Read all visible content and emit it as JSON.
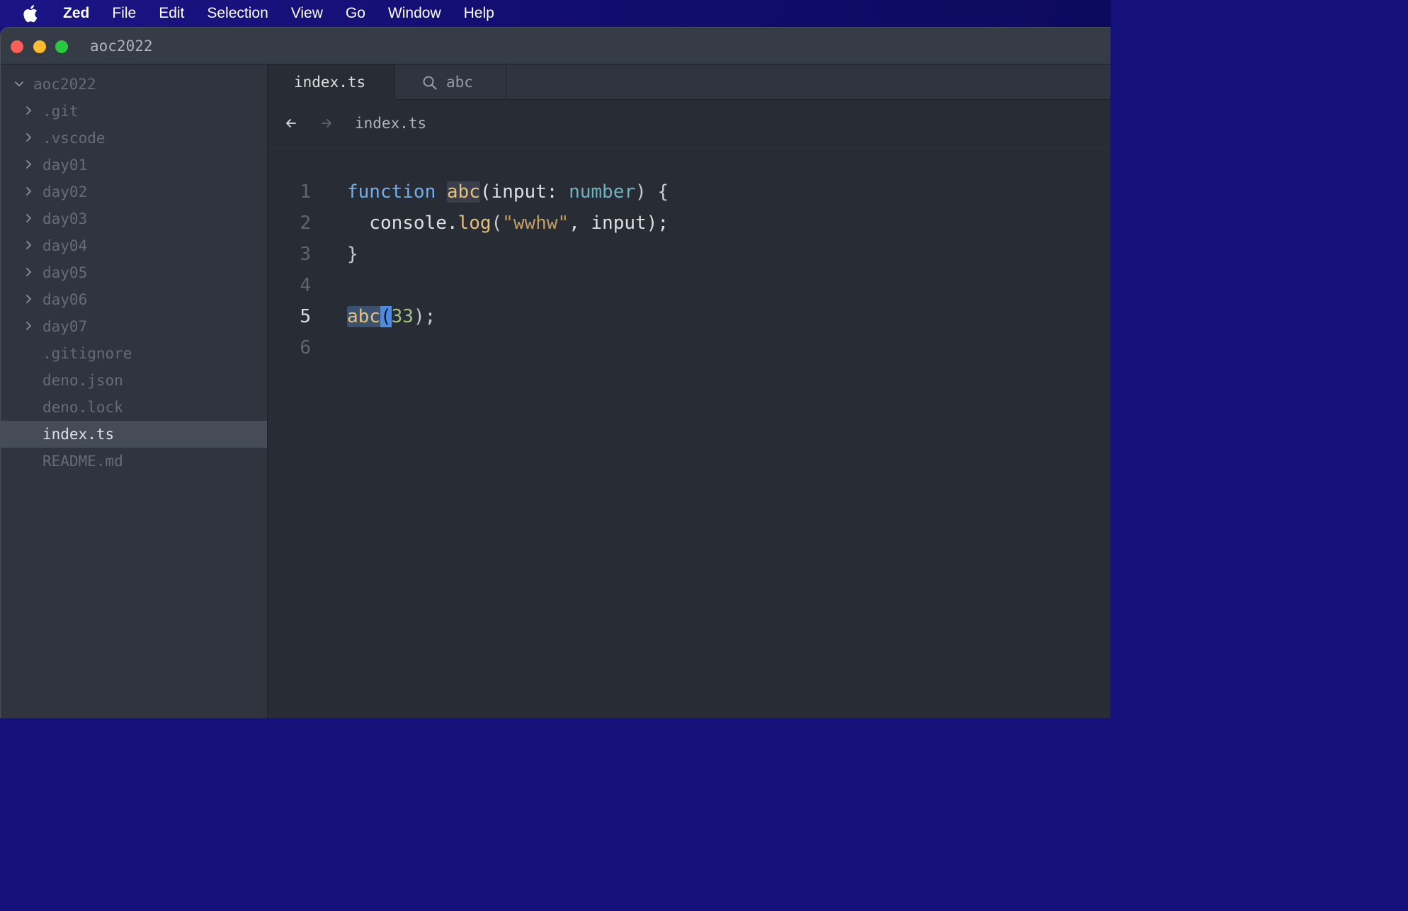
{
  "menubar": {
    "app_name": "Zed",
    "items": [
      "File",
      "Edit",
      "Selection",
      "View",
      "Go",
      "Window",
      "Help"
    ]
  },
  "window": {
    "title": "aoc2022"
  },
  "sidebar": {
    "root": "aoc2022",
    "items": [
      {
        "label": ".git",
        "type": "folder"
      },
      {
        "label": ".vscode",
        "type": "folder"
      },
      {
        "label": "day01",
        "type": "folder"
      },
      {
        "label": "day02",
        "type": "folder"
      },
      {
        "label": "day03",
        "type": "folder"
      },
      {
        "label": "day04",
        "type": "folder"
      },
      {
        "label": "day05",
        "type": "folder"
      },
      {
        "label": "day06",
        "type": "folder"
      },
      {
        "label": "day07",
        "type": "folder"
      },
      {
        "label": ".gitignore",
        "type": "file"
      },
      {
        "label": "deno.json",
        "type": "file"
      },
      {
        "label": "deno.lock",
        "type": "file"
      },
      {
        "label": "index.ts",
        "type": "file",
        "selected": true
      },
      {
        "label": "README.md",
        "type": "file"
      }
    ]
  },
  "tabs": [
    {
      "label": "index.ts",
      "active": true
    },
    {
      "label": "abc",
      "icon": "search-icon",
      "active": false
    }
  ],
  "toolbar": {
    "breadcrumb": "index.ts"
  },
  "editor": {
    "current_line": 5,
    "lines": [
      {
        "number": "1",
        "tokens": [
          {
            "t": "function",
            "c": "kw"
          },
          {
            "t": " ",
            "c": ""
          },
          {
            "t": "abc",
            "c": "fn hl-word"
          },
          {
            "t": "(input: ",
            "c": ""
          },
          {
            "t": "number",
            "c": "ty"
          },
          {
            "t": ") {",
            "c": "punct"
          }
        ]
      },
      {
        "number": "2",
        "tokens": [
          {
            "t": "  console.",
            "c": ""
          },
          {
            "t": "log",
            "c": "fn"
          },
          {
            "t": "(",
            "c": "punct"
          },
          {
            "t": "\"wwhw\"",
            "c": "str"
          },
          {
            "t": ", input);",
            "c": ""
          }
        ]
      },
      {
        "number": "3",
        "tokens": [
          {
            "t": "}",
            "c": "punct"
          }
        ]
      },
      {
        "number": "4",
        "tokens": []
      },
      {
        "number": "5",
        "tokens": [
          {
            "t": "abc",
            "c": "fn hl-sel"
          },
          {
            "t": "(",
            "c": "cursor"
          },
          {
            "t": "33",
            "c": "num"
          },
          {
            "t": ");",
            "c": "punct"
          }
        ]
      },
      {
        "number": "6",
        "tokens": []
      }
    ]
  },
  "colors": {
    "editor_bg": "#282c34",
    "sidebar_bg": "#2f343e",
    "keyword": "#74ade8",
    "function": "#e5c07b",
    "string": "#c29d63",
    "number": "#a1c181",
    "cursor": "#4d8ae0"
  }
}
